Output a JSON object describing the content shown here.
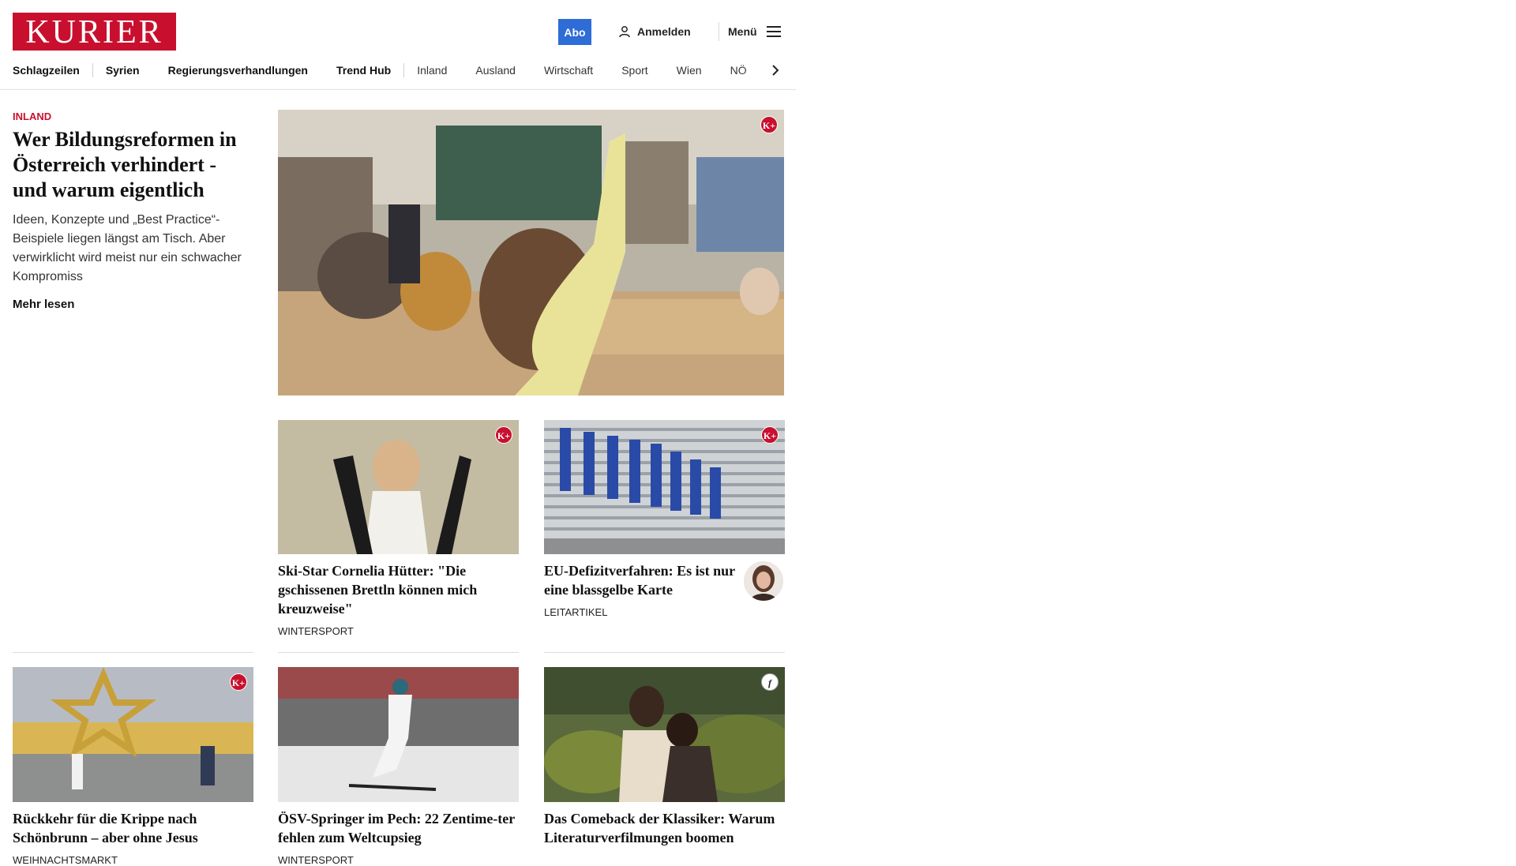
{
  "brand": {
    "logo_text": "KURIER",
    "color": "#c8102e"
  },
  "header": {
    "abo_label": "Abo",
    "login_label": "Anmelden",
    "menu_label": "Menü"
  },
  "nav": {
    "items": [
      "Schlagzeilen",
      "Syrien",
      "Regierungsverhandlungen",
      "Trend Hub",
      "Inland",
      "Ausland",
      "Wirtschaft",
      "Sport",
      "Wien",
      "NÖ"
    ]
  },
  "lead": {
    "category": "Inland",
    "title": "Wer Bildungsreformen in Österreich verhindert - und warum eigentlich",
    "description": "Ideen, Konzepte und „Best Practice“-Beispiele liegen längst am Tisch. Aber verwirklicht wird meist nur ein schwacher Kompromiss",
    "more_label": "Mehr lesen",
    "badge": "K+"
  },
  "cards": [
    {
      "title": "Ski-Star Cornelia Hütter: \"Die gschissenen Brettln können mich kreuzweise\"",
      "category": "Wintersport",
      "badge": "K+"
    },
    {
      "title": "EU-Defizitverfahren: Es ist nur eine blassgelbe Karte",
      "category": "Leitartikel",
      "badge": "K+"
    },
    {
      "title": "Rückkehr für die Krippe nach Schönbrunn – aber ohne Jesus",
      "category": "Weihnachtsmarkt",
      "badge": "K+"
    },
    {
      "title": "ÖSV-Springer im Pech: 22 Zentime-ter fehlen zum Weltcupsieg",
      "category": "Wintersport",
      "badge": ""
    },
    {
      "title": "Das Comeback der Klassiker: Warum Literaturverfilmungen boomen",
      "category": "",
      "badge": "f"
    }
  ],
  "icons": {
    "user": "user-icon",
    "menu": "hamburger-icon",
    "arrow": "chevron-right-icon"
  }
}
